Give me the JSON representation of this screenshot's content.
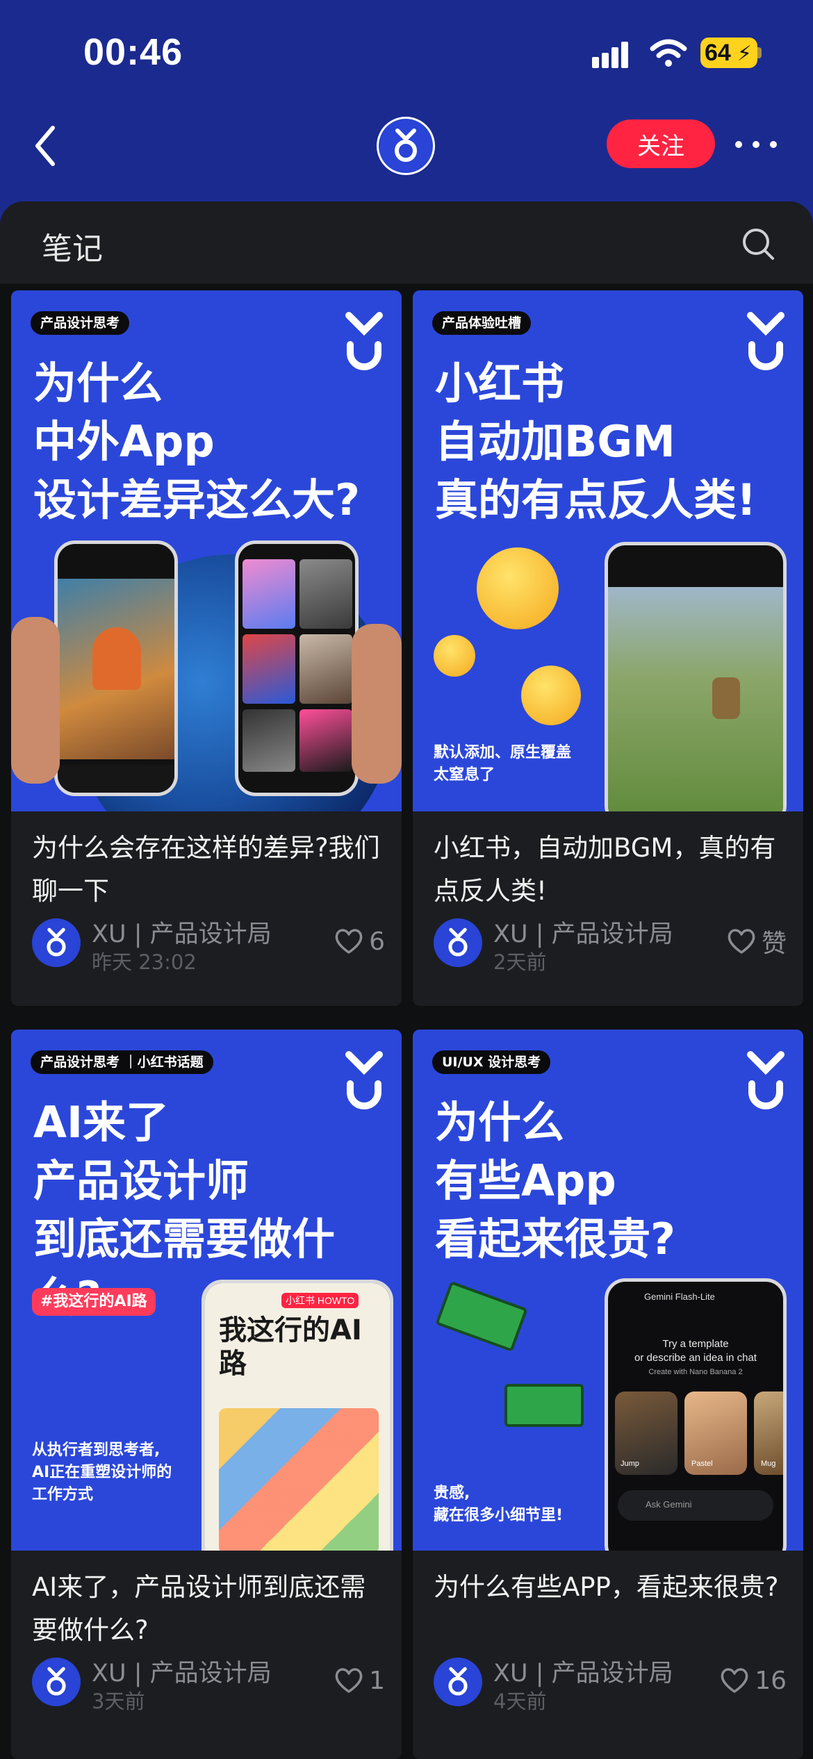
{
  "status_bar": {
    "time": "00:46",
    "battery": "64"
  },
  "nav": {
    "follow_label": "关注"
  },
  "tabs": {
    "notes_label": "笔记"
  },
  "cards": [
    {
      "tag": "产品设计思考",
      "headline": "为什么\n中外App\n设计差异这么大?",
      "title": "为什么会存在这样的差异?我们聊一下",
      "author": "XU | 产品设计局",
      "date": "昨天 23:02",
      "likes": "6"
    },
    {
      "tag": "产品体验吐槽",
      "headline": "小红书\n自动加BGM\n真的有点反人类!",
      "subtitle": "默认添加、原生覆盖\n太窒息了",
      "title": "小红书，自动加BGM，真的有点反人类!",
      "author": "XU | 产品设计局",
      "date": "2天前",
      "likes": "赞"
    },
    {
      "tag": "产品设计思考 ｜小红书话题",
      "headline": "AI来了\n产品设计师\n到底还需要做什么?",
      "hashtag": "#我这行的AI路",
      "subtitle": "从执行者到思考者,\nAI正在重塑设计师的\n工作方式",
      "title": "AI来了，产品设计师到底还需要做什么?",
      "author": "XU | 产品设计局",
      "date": "3天前",
      "likes": "1"
    },
    {
      "tag": "UI/UX 设计思考",
      "headline": "为什么\n有些App\n看起来很贵?",
      "subtitle": "贵感,\n藏在很多小细节里!",
      "title": "为什么有些APP，看起来很贵?",
      "author": "XU | 产品设计局",
      "date": "4天前",
      "likes": "16"
    }
  ],
  "phone_screens": {
    "gemini_brand": "Gemini Flash-Lite",
    "gemini_prompt": "Try a template\nor describe an idea in chat",
    "gemini_sub": "Create with Nano Banana 2",
    "gemini_input": "Ask Gemini",
    "gemini_chips": [
      "Jump",
      "Pastel",
      "Mug"
    ],
    "ai_poster_title": "我这行的AI路",
    "ai_poster_badge": "小红书 HOWTO"
  },
  "colors": {
    "accent": "#ff2442",
    "brand_blue": "#2b47d9",
    "header_bg": "#1b2a8f"
  }
}
